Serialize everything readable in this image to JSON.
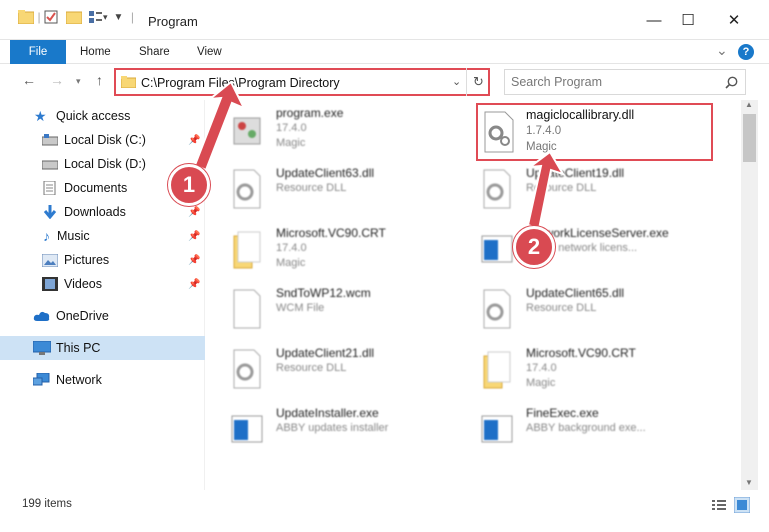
{
  "window": {
    "title": "Program",
    "minimize": "—",
    "maximize": "☐",
    "close": "✕"
  },
  "ribbon": {
    "tabs": [
      "File",
      "Home",
      "Share",
      "View"
    ],
    "help": "?",
    "collapse": "⌄"
  },
  "address": {
    "path": "C:\\Program Files\\Program Directory",
    "search_placeholder": "Search Program"
  },
  "sidebar": {
    "items": [
      {
        "label": "Quick access",
        "icon": "star-icon"
      },
      {
        "label": "Local Disk (C:)",
        "icon": "drive-icon",
        "pinned": true
      },
      {
        "label": "Local Disk (D:)",
        "icon": "drive-icon"
      },
      {
        "label": "Documents",
        "icon": "documents-icon",
        "pinned": true
      },
      {
        "label": "Downloads",
        "icon": "download-icon",
        "pinned": true
      },
      {
        "label": "Music",
        "icon": "music-icon",
        "pinned": true
      },
      {
        "label": "Pictures",
        "icon": "pictures-icon",
        "pinned": true
      },
      {
        "label": "Videos",
        "icon": "videos-icon",
        "pinned": true
      },
      {
        "label": "OneDrive",
        "icon": "cloud-icon"
      },
      {
        "label": "This PC",
        "icon": "computer-icon",
        "selected": true
      },
      {
        "label": "Network",
        "icon": "network-icon"
      }
    ]
  },
  "files": [
    {
      "name": "program.exe",
      "line1": "17.4.0",
      "line2": "Magic",
      "type": "exe"
    },
    {
      "name": "magiclocallibrary.dll",
      "line1": "1.7.4.0",
      "line2": "Magic",
      "type": "dll",
      "highlighted": true
    },
    {
      "name": "UpdateClient63.dll",
      "line1": "Resource DLL",
      "line2": "",
      "type": "doc"
    },
    {
      "name": "UpdateClient19.dll",
      "line1": "Resource DLL",
      "line2": "",
      "type": "doc"
    },
    {
      "name": "Microsoft.VC90.CRT",
      "line1": "17.4.0",
      "line2": "Magic",
      "type": "folder"
    },
    {
      "name": "NetworkLicenseServer.exe",
      "line1": "ABBY network licens...",
      "line2": "",
      "type": "app"
    },
    {
      "name": "SndToWP12.wcm",
      "line1": "WCM File",
      "line2": "",
      "type": "doc"
    },
    {
      "name": "UpdateClient65.dll",
      "line1": "Resource DLL",
      "line2": "",
      "type": "doc"
    },
    {
      "name": "UpdateClient21.dll",
      "line1": "Resource DLL",
      "line2": "",
      "type": "doc"
    },
    {
      "name": "Microsoft.VC90.CRT",
      "line1": "17.4.0",
      "line2": "Magic",
      "type": "folder"
    },
    {
      "name": "UpdateInstaller.exe",
      "line1": "ABBY updates installer",
      "line2": "",
      "type": "app"
    },
    {
      "name": "FineExec.exe",
      "line1": "ABBY background exe...",
      "line2": "",
      "type": "app"
    }
  ],
  "status": {
    "item_count": "199 items"
  },
  "annotations": [
    "1",
    "2"
  ],
  "colors": {
    "accent": "#1979ca",
    "annotation": "#d94a52",
    "selection": "#cde2f5"
  }
}
